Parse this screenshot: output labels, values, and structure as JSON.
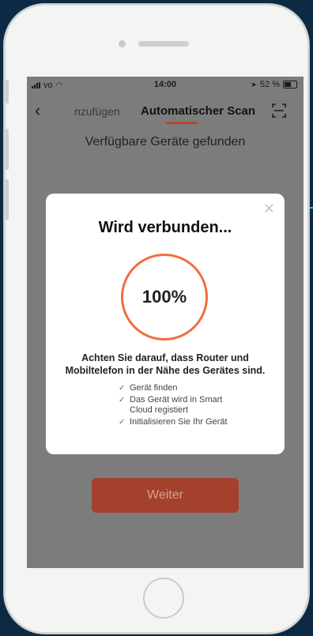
{
  "status_bar": {
    "carrier": "vo",
    "time": "14:00",
    "battery_percent": "52 %"
  },
  "nav": {
    "tab_left": "nzufügen",
    "tab_active": "Automatischer Scan"
  },
  "heading": "Verfügbare Geräte gefunden",
  "modal": {
    "title": "Wird verbunden...",
    "progress": "100%",
    "warning_line1": "Achten Sie darauf, dass Router und",
    "warning_line2": "Mobiltelefon in der Nähe des Gerätes sind.",
    "steps": [
      {
        "line1": "Gerät finden",
        "line2": ""
      },
      {
        "line1": "Das Gerät wird in Smart",
        "line2": "Cloud registiert"
      },
      {
        "line1": "Initialisieren Sie Ihr Gerät",
        "line2": ""
      }
    ]
  },
  "next_button": "Weiter",
  "colors": {
    "accent": "#f16d3f",
    "button": "#a4412d",
    "overlay": "#7c7c7c",
    "background": "#0d2a44",
    "line": "#35c3c4"
  }
}
